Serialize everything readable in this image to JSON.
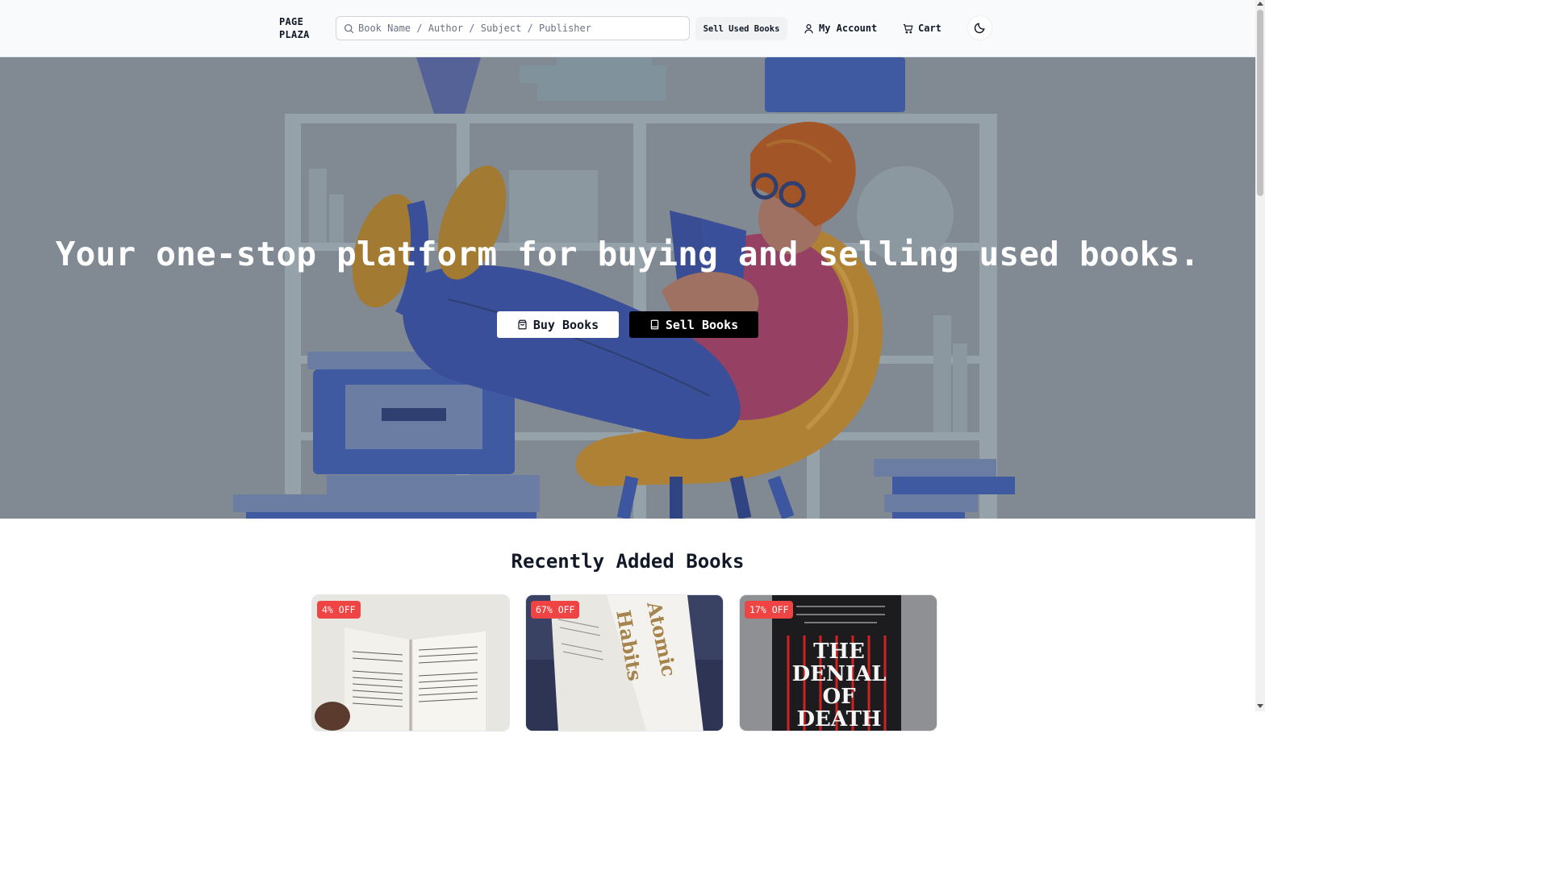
{
  "header": {
    "logo_line1": "PAGE",
    "logo_line2": "PLAZA",
    "search_placeholder": "Book Name / Author / Subject / Publisher",
    "sell_used_label": "Sell Used Books",
    "account_label": "My Account",
    "cart_label": "Cart",
    "theme_icon": "moon-icon"
  },
  "hero": {
    "title": "Your one-stop platform for buying and selling used books.",
    "buy_label": "Buy Books",
    "sell_label": "Sell Books",
    "buy_icon": "shopping-bag-icon",
    "sell_icon": "book-icon"
  },
  "recent": {
    "title": "Recently Added Books",
    "books": [
      {
        "discount": "4% OFF"
      },
      {
        "discount": "67% OFF"
      },
      {
        "discount": "17% OFF"
      }
    ]
  },
  "colors": {
    "badge": "#ef4444",
    "header_bg": "#f9fafb",
    "hero_overlay": "#8e97a0",
    "sell_button": "#000000"
  }
}
